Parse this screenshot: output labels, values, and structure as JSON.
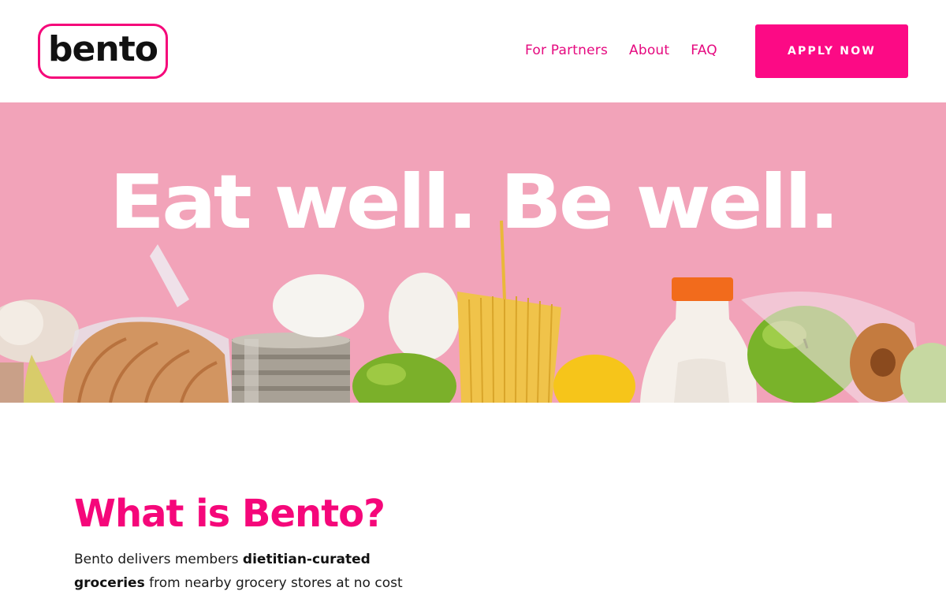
{
  "header": {
    "logo_text": "bento",
    "nav": [
      {
        "label": "For Partners"
      },
      {
        "label": "About"
      },
      {
        "label": "FAQ"
      }
    ],
    "cta_label": "APPLY NOW"
  },
  "hero": {
    "title": "Eat well. Be well."
  },
  "about": {
    "title": "What is Bento?",
    "body_part1": "Bento delivers members ",
    "body_bold1": "dietitian-curated",
    "body_bold2": "groceries",
    "body_part2": " from nearby grocery stores at no cost"
  },
  "colors": {
    "brand_pink": "#fc0a85",
    "hero_background": "#f2a3b9"
  }
}
